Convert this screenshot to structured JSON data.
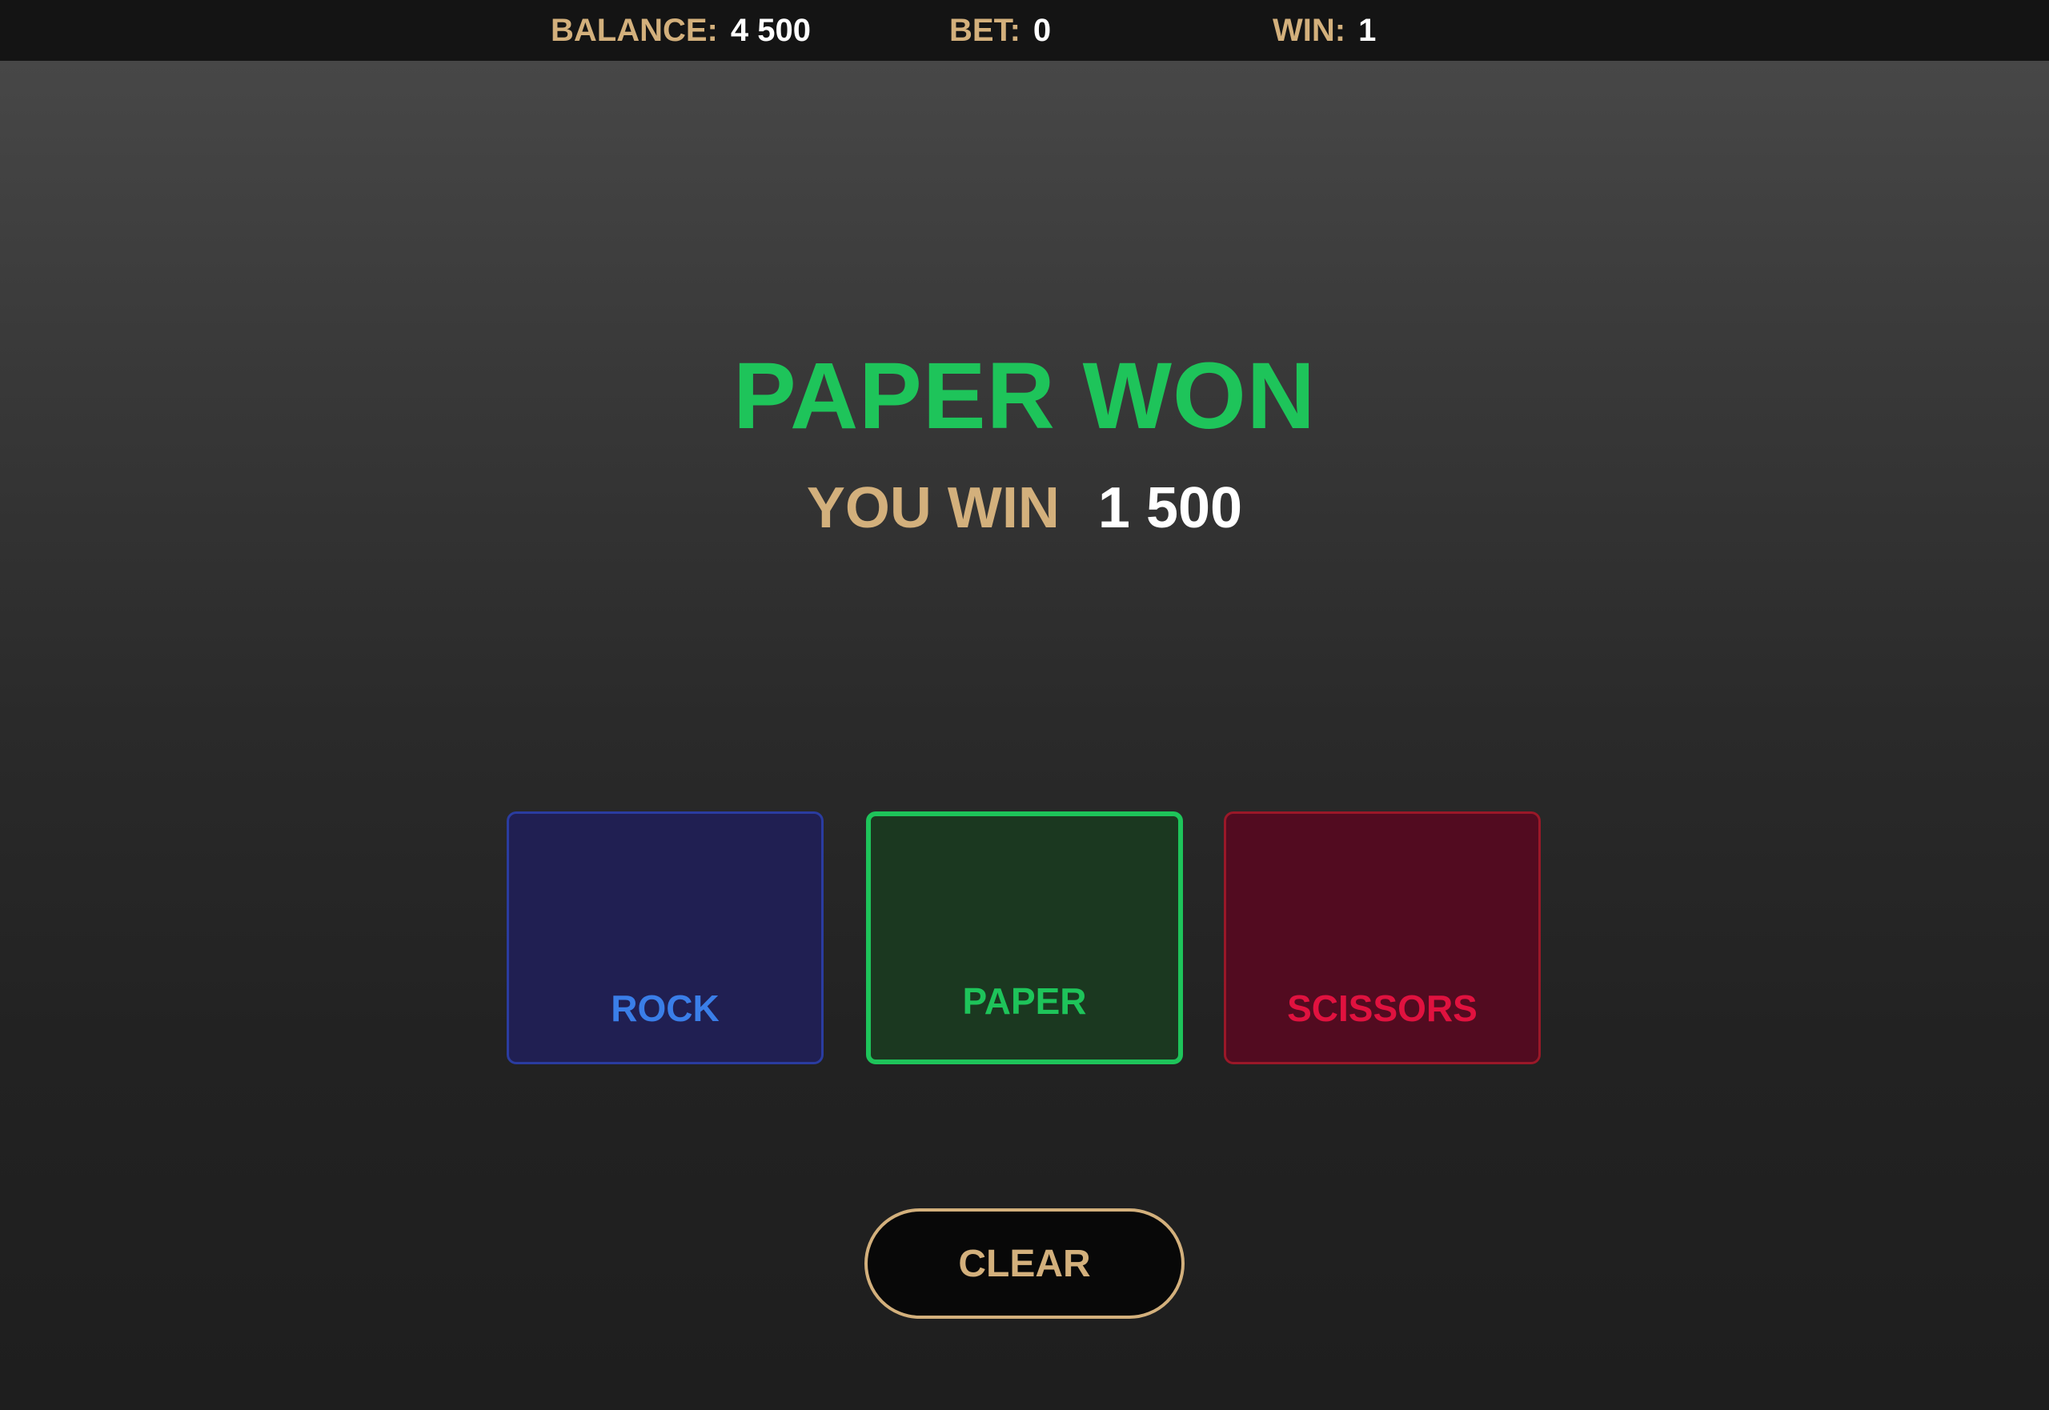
{
  "topbar": {
    "balance_label": "BALANCE:",
    "balance_value": "4 500",
    "bet_label": "BET:",
    "bet_value": "0",
    "win_label": "WIN:",
    "win_value": "1"
  },
  "result": {
    "title": "PAPER WON",
    "win_label": "YOU WIN",
    "win_amount": "1 500"
  },
  "choices": [
    {
      "label": "ROCK",
      "color": "#3a7ee8",
      "selected": false
    },
    {
      "label": "PAPER",
      "color": "#1ec45a",
      "selected": true
    },
    {
      "label": "SCISSORS",
      "color": "#e0123f",
      "selected": false
    }
  ],
  "actions": {
    "clear_label": "CLEAR"
  },
  "colors": {
    "accent_gold": "#d3b07c",
    "win_green": "#1ec45a",
    "rock_blue": "#3a7ee8",
    "scissors_red": "#e0123f"
  }
}
